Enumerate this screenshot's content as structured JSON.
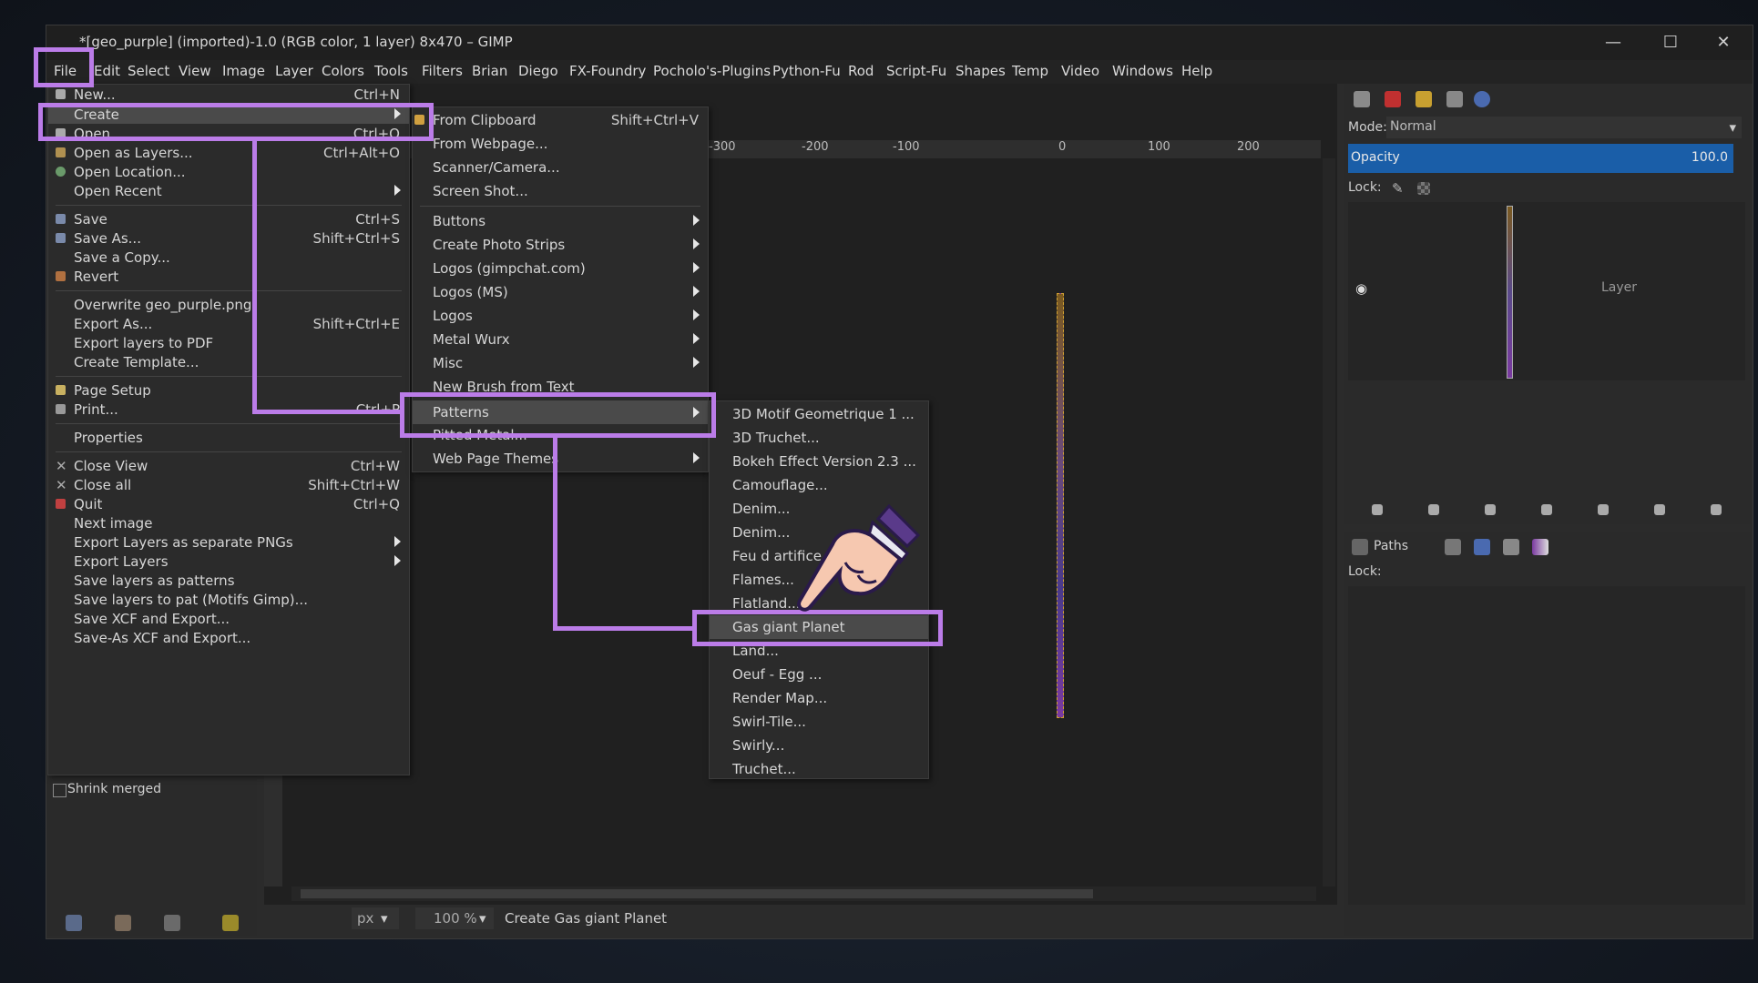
{
  "window": {
    "title": "*[geo_purple] (imported)-1.0 (RGB color, 1 layer) 8x470 – GIMP",
    "controls": {
      "minimize": "—",
      "maximize": "☐",
      "close": "✕"
    }
  },
  "menubar": [
    "File",
    "Edit",
    "Select",
    "View",
    "Image",
    "Layer",
    "Colors",
    "Tools",
    "Filters",
    "Brian",
    "Diego",
    "FX-Foundry",
    "Pocholo's-Plugins",
    "Python-Fu",
    "Rod",
    "Script-Fu",
    "Shapes",
    "Temp",
    "Video",
    "Windows",
    "Help"
  ],
  "file_menu": {
    "items": [
      {
        "label": "New...",
        "accel": "Ctrl+N"
      },
      {
        "label": "Create",
        "accel": ""
      },
      {
        "label": "Open...",
        "accel": "Ctrl+O"
      },
      {
        "label": "Open as Layers...",
        "accel": "Ctrl+Alt+O"
      },
      {
        "label": "Open Location...",
        "accel": ""
      },
      {
        "label": "Open Recent",
        "accel": ""
      },
      {
        "label": "Save",
        "accel": "Ctrl+S"
      },
      {
        "label": "Save As...",
        "accel": "Shift+Ctrl+S"
      },
      {
        "label": "Save a Copy...",
        "accel": ""
      },
      {
        "label": "Revert",
        "accel": ""
      },
      {
        "label": "Overwrite geo_purple.png",
        "accel": ""
      },
      {
        "label": "Export As...",
        "accel": "Shift+Ctrl+E"
      },
      {
        "label": "Export layers to PDF",
        "accel": ""
      },
      {
        "label": "Create Template...",
        "accel": ""
      },
      {
        "label": "Page Setup",
        "accel": ""
      },
      {
        "label": "Print...",
        "accel": "Ctrl+P"
      },
      {
        "label": "Properties",
        "accel": ""
      },
      {
        "label": "Close View",
        "accel": "Ctrl+W"
      },
      {
        "label": "Close all",
        "accel": "Shift+Ctrl+W"
      },
      {
        "label": "Quit",
        "accel": "Ctrl+Q"
      },
      {
        "label": "Next image",
        "accel": ""
      },
      {
        "label": "Export Layers as separate PNGs",
        "accel": ""
      },
      {
        "label": "Export Layers",
        "accel": ""
      },
      {
        "label": "Save layers as patterns",
        "accel": ""
      },
      {
        "label": "Save layers to pat (Motifs Gimp)...",
        "accel": ""
      },
      {
        "label": "Save XCF and Export...",
        "accel": ""
      },
      {
        "label": "Save-As XCF and Export...",
        "accel": ""
      }
    ]
  },
  "create_menu": {
    "items": [
      {
        "label": "From Clipboard",
        "accel": "Shift+Ctrl+V"
      },
      {
        "label": "From Webpage...",
        "accel": ""
      },
      {
        "label": "Scanner/Camera...",
        "accel": ""
      },
      {
        "label": "Screen Shot...",
        "accel": ""
      },
      {
        "label": "Buttons",
        "accel": ""
      },
      {
        "label": "Create Photo Strips",
        "accel": ""
      },
      {
        "label": "Logos (gimpchat.com)",
        "accel": ""
      },
      {
        "label": "Logos (MS)",
        "accel": ""
      },
      {
        "label": "Logos",
        "accel": ""
      },
      {
        "label": "Metal Wurx",
        "accel": ""
      },
      {
        "label": "Misc",
        "accel": ""
      },
      {
        "label": "New Brush from Text",
        "accel": ""
      },
      {
        "label": "Patterns",
        "accel": ""
      },
      {
        "label": "Pitted Metal...",
        "accel": ""
      },
      {
        "label": "Web Page Themes",
        "accel": ""
      }
    ]
  },
  "patterns_menu": {
    "items": [
      "3D Motif Geometrique 1 ...",
      "3D Truchet...",
      "Bokeh Effect Version 2.3 ...",
      "Camouflage...",
      "Denim...",
      "Denim...",
      "Feu d artifice - Fi...",
      "Flames...",
      "Flatland...",
      "Gas giant Planet",
      "Land...",
      "Oeuf - Egg ...",
      "Render Map...",
      "Swirl-Tile...",
      "Swirly...",
      "Truchet..."
    ]
  },
  "ruler": {
    "ticks": [
      "-300",
      "-200",
      "-100",
      "0",
      "100",
      "200"
    ]
  },
  "left_panel": {
    "shrink_merged": "Shrink merged"
  },
  "statusbar": {
    "unit": "px",
    "zoom": "100 %",
    "message": "Create Gas giant Planet"
  },
  "layers": {
    "mode_label": "Mode:",
    "mode_value": "Normal",
    "opacity_label": "Opacity",
    "opacity_value": "100.0",
    "lock_label": "Lock:",
    "layer_name": "Layer"
  },
  "paths_panel": {
    "tab": "Paths",
    "lock_label": "Lock:"
  },
  "colors": {
    "highlight": "#bb7ce8",
    "menu_bg": "#2b2b2b",
    "hover": "#4a4a4a",
    "opacity_bar": "#1a5ea8"
  }
}
